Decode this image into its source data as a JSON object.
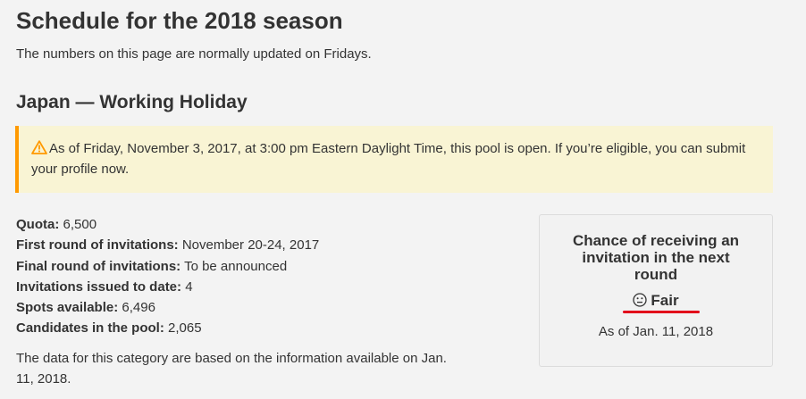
{
  "page": {
    "title": "Schedule for the 2018 season",
    "intro": "The numbers on this page are normally updated on Fridays."
  },
  "section": {
    "title": "Japan — Working Holiday"
  },
  "alert": {
    "icon": "warning-icon",
    "color": "#ff9900",
    "text": "As of Friday, November 3, 2017, at 3:00 pm Eastern Daylight Time, this pool is open. If you’re eligible, you can submit your profile now."
  },
  "facts": [
    {
      "label": "Quota:",
      "value": "6,500"
    },
    {
      "label": "First round of invitations:",
      "value": "November 20-24, 2017"
    },
    {
      "label": "Final round of invitations:",
      "value": "To be announced"
    },
    {
      "label": "Invitations issued to date:",
      "value": "4"
    },
    {
      "label": "Spots available:",
      "value": "6,496"
    },
    {
      "label": "Candidates in the pool:",
      "value": "2,065"
    }
  ],
  "note": "The data for this category are based on the information available on Jan. 11, 2018.",
  "chance": {
    "title": "Chance of receiving an invitation in the next round",
    "icon": "neutral-face-icon",
    "rating": "Fair",
    "underline_color": "#e2001a",
    "as_of": "As of Jan. 11, 2018"
  }
}
